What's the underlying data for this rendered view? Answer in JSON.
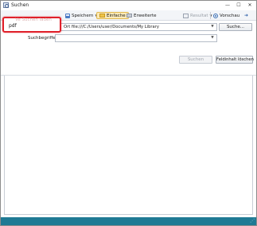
{
  "window": {
    "title": "Suchen",
    "colors": {
      "statusbar": "#1f7a94",
      "highlight": "#e0202a"
    }
  },
  "controls": {
    "minimize": "—",
    "maximize": "☐",
    "close": "✕"
  },
  "toolbar": {
    "load_label": "Suchen laden",
    "save_label": "Speichern",
    "simple_label": "Einfache",
    "advanced_label": "Erweiterte",
    "results_label": "Resultat",
    "preview_label": "Vorschau",
    "icons": [
      "save-icon",
      "simple-search-icon",
      "advanced-search-icon",
      "results-icon",
      "preview-icon",
      "pin-icon"
    ]
  },
  "form": {
    "location_value": "Ort file:///C:/Users/user/Documents/My Library",
    "browse_label": "Suche...",
    "keyword_label": "Suchbegriffe:",
    "keyword_value": "",
    "search_label": "Suchen",
    "clear_label": "Feldinhalt löschen"
  },
  "highlight_box": {
    "ghost_text": "Ve Suchen laden",
    "value": "pdf"
  }
}
